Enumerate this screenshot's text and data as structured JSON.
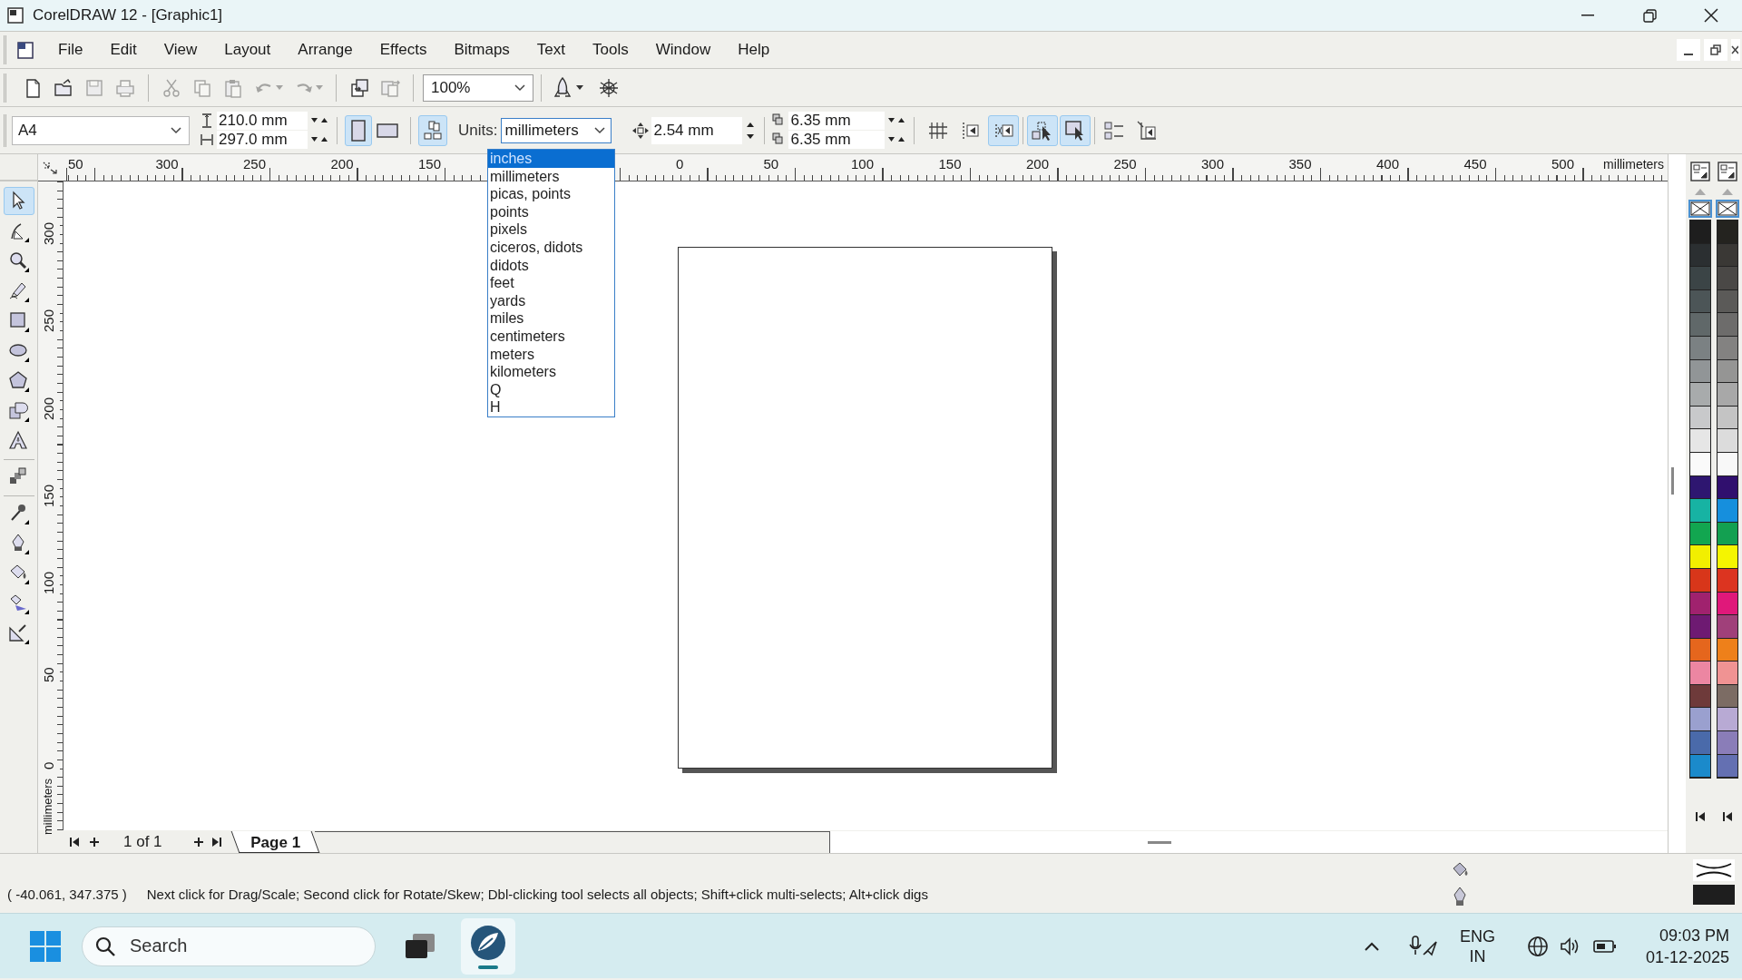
{
  "window": {
    "title": "CorelDRAW 12 - [Graphic1]"
  },
  "menu": [
    "File",
    "Edit",
    "View",
    "Layout",
    "Arrange",
    "Effects",
    "Bitmaps",
    "Text",
    "Tools",
    "Window",
    "Help"
  ],
  "standard_toolbar": {
    "buttons": [
      {
        "kind": "new",
        "disabled": false
      },
      {
        "kind": "open",
        "disabled": false
      },
      {
        "kind": "save",
        "disabled": true
      },
      {
        "kind": "print",
        "disabled": true
      },
      {
        "kind": "cut",
        "disabled": true
      },
      {
        "kind": "copy",
        "disabled": true
      },
      {
        "kind": "paste",
        "disabled": true
      },
      {
        "kind": "undo",
        "disabled": true
      },
      {
        "kind": "redo",
        "disabled": true
      },
      {
        "kind": "import",
        "disabled": false
      },
      {
        "kind": "export",
        "disabled": true
      }
    ],
    "zoom": "100%"
  },
  "property_bar": {
    "paper_size": "A4",
    "width": "210.0 mm",
    "height": "297.0 mm",
    "orientations": [
      {
        "kind": "portrait",
        "selected": true
      },
      {
        "kind": "landscape",
        "selected": false
      }
    ],
    "apply_all_pages": true,
    "units_label": "Units:",
    "units": "millimeters",
    "nudge": "2.54 mm",
    "duplicate_x": "6.35 mm",
    "duplicate_y": "6.35 mm",
    "toggles": [
      {
        "kind": "grid",
        "on": false
      },
      {
        "kind": "guides",
        "on": false
      },
      {
        "kind": "objects",
        "on": true
      },
      {
        "kind": "select",
        "on": true
      },
      {
        "kind": "marquee",
        "on": true
      },
      {
        "kind": "checklist",
        "on": false
      },
      {
        "kind": "snap",
        "on": false
      }
    ]
  },
  "units_dropdown": {
    "options": [
      {
        "label": "inches",
        "selected": true
      },
      {
        "label": "millimeters",
        "selected": false
      },
      {
        "label": "picas, points",
        "selected": false
      },
      {
        "label": "points",
        "selected": false
      },
      {
        "label": "pixels",
        "selected": false
      },
      {
        "label": "ciceros, didots",
        "selected": false
      },
      {
        "label": "didots",
        "selected": false
      },
      {
        "label": "feet",
        "selected": false
      },
      {
        "label": "yards",
        "selected": false
      },
      {
        "label": "miles",
        "selected": false
      },
      {
        "label": "centimeters",
        "selected": false
      },
      {
        "label": "meters",
        "selected": false
      },
      {
        "label": "kilometers",
        "selected": false
      },
      {
        "label": "Q",
        "selected": false
      },
      {
        "label": "H",
        "selected": false
      }
    ]
  },
  "horizontal_ruler": {
    "left_labels": [
      "50",
      "300",
      "250",
      "200",
      "150"
    ],
    "right_labels": [
      "0",
      "50",
      "100",
      "150",
      "200",
      "250",
      "300",
      "350",
      "400",
      "450",
      "500"
    ],
    "unit": "millimeters"
  },
  "vertical_ruler": {
    "labels": [
      "300",
      "250",
      "200",
      "150",
      "100",
      "50",
      "0"
    ],
    "unit": "millimeters"
  },
  "toolbox": [
    {
      "kind": "pick",
      "selected": true
    },
    {
      "kind": "shape",
      "selected": false
    },
    {
      "kind": "zoom",
      "selected": false
    },
    {
      "kind": "freehand",
      "selected": false
    },
    {
      "kind": "rectangle",
      "selected": false
    },
    {
      "kind": "ellipse",
      "selected": false
    },
    {
      "kind": "polygon",
      "selected": false
    },
    {
      "kind": "shapes",
      "selected": false
    },
    {
      "kind": "text",
      "selected": false
    },
    {
      "kind": "blend",
      "selected": false
    },
    {
      "kind": "eyedropper",
      "selected": false
    },
    {
      "kind": "outline",
      "selected": false
    },
    {
      "kind": "fill",
      "selected": false
    },
    {
      "kind": "interactive-fill",
      "selected": false
    },
    {
      "kind": "dimension",
      "selected": false
    }
  ],
  "page_navigation": {
    "counter": "1 of 1",
    "tabs": [
      {
        "label": "Page 1",
        "selected": true
      }
    ]
  },
  "palettes": [
    {
      "colors": [
        {
          "color": "#1e1e1e"
        },
        {
          "color": "#2b2f31"
        },
        {
          "color": "#3b4446"
        },
        {
          "color": "#4c5557"
        },
        {
          "color": "#606869"
        },
        {
          "color": "#7b8183"
        },
        {
          "color": "#919597"
        },
        {
          "color": "#a8abac"
        },
        {
          "color": "#c8c9cb"
        },
        {
          "color": "#e6e6e6"
        },
        {
          "color": "#fafafa"
        },
        {
          "color": "#2e1670"
        },
        {
          "color": "#17b3a3"
        },
        {
          "color": "#12a650"
        },
        {
          "color": "#f2ef00"
        },
        {
          "color": "#d8361a"
        },
        {
          "color": "#a0226e"
        },
        {
          "color": "#6e1a72"
        },
        {
          "color": "#e5661d"
        },
        {
          "color": "#ec86a2"
        },
        {
          "color": "#6e3a3a"
        },
        {
          "color": "#9aa0cf"
        },
        {
          "color": "#4a6aaa"
        },
        {
          "color": "#1b8acb"
        }
      ]
    },
    {
      "colors": [
        {
          "color": "#24231f"
        },
        {
          "color": "#3a3835"
        },
        {
          "color": "#4a4846"
        },
        {
          "color": "#5b5a58"
        },
        {
          "color": "#6d6c6b"
        },
        {
          "color": "#838281"
        },
        {
          "color": "#959594"
        },
        {
          "color": "#a8a8a8"
        },
        {
          "color": "#c4c4c4"
        },
        {
          "color": "#dcdcdc"
        },
        {
          "color": "#f8f8f8"
        },
        {
          "color": "#300f6e"
        },
        {
          "color": "#168fdd"
        },
        {
          "color": "#13a051"
        },
        {
          "color": "#f5f500"
        },
        {
          "color": "#dc3420"
        },
        {
          "color": "#e0187a"
        },
        {
          "color": "#a0407a"
        },
        {
          "color": "#ee801a"
        },
        {
          "color": "#f09393"
        },
        {
          "color": "#7c6c64"
        },
        {
          "color": "#b8aad4"
        },
        {
          "color": "#8a7db8"
        },
        {
          "color": "#6470b2"
        }
      ]
    }
  ],
  "status_bar": {
    "coordinates": "( -40.061, 347.375 )",
    "hint": "Next click for Drag/Scale; Second click for Rotate/Skew; Dbl-clicking tool selects all objects; Shift+click multi-selects; Alt+click digs"
  },
  "taskbar": {
    "search_placeholder": "Search",
    "language": "ENG",
    "region": "IN",
    "time": "09:03 PM",
    "date": "01-12-2025"
  }
}
